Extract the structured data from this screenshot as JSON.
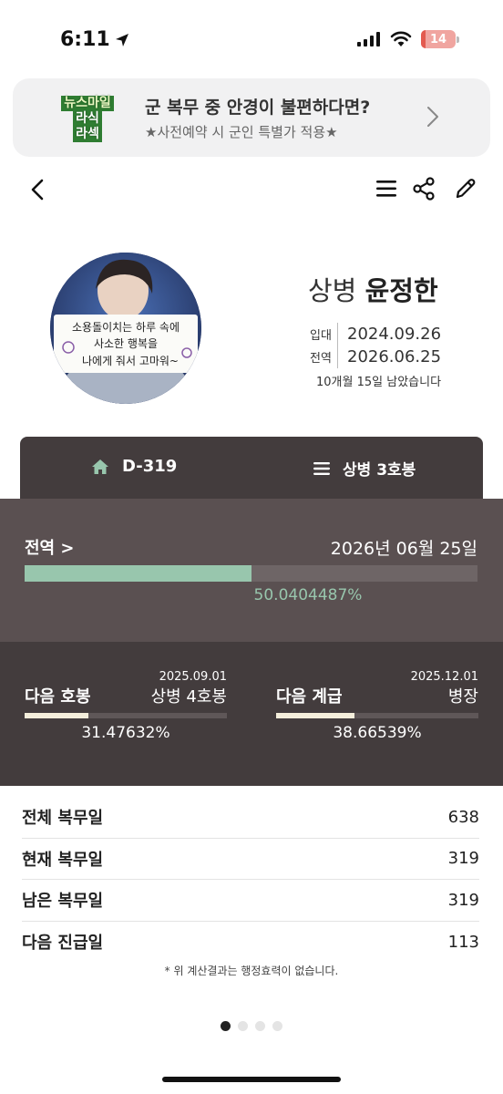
{
  "status_bar": {
    "time": "6:11",
    "battery": "14",
    "battery_level": 0.14
  },
  "ad": {
    "logo_lines": [
      "뉴스마일",
      "라식",
      "라섹"
    ],
    "title": "군 복무 중 안경이 불편하다면?",
    "subtitle": "★사전예약 시 군인 특별가 적용★"
  },
  "nav": {
    "icons": [
      "back-chevron-icon",
      "menu-icon",
      "share-icon",
      "edit-pencil-icon"
    ]
  },
  "profile": {
    "rank": "상병",
    "name": "윤정한",
    "enlist_label": "입대",
    "enlist_date": "2024.09.26",
    "discharge_label": "전역",
    "discharge_date": "2026.06.25",
    "remaining": "10개월 15일 남았습니다"
  },
  "tabs": {
    "dday": "D-319",
    "grade": "상병 3호봉"
  },
  "discharge": {
    "label": "전역 >",
    "date": "2026년 06월 25일",
    "percent_text": "50.0404487%",
    "progress": 0.500404487
  },
  "next": {
    "step": {
      "title": "다음 호봉",
      "date": "2025.09.01",
      "value": "상병 4호봉",
      "percent_text": "31.47632%",
      "progress": 0.3147632
    },
    "rank": {
      "title": "다음 계급",
      "date": "2025.12.01",
      "value": "병장",
      "percent_text": "38.66539%",
      "progress": 0.3866539
    }
  },
  "stats": [
    {
      "label": "전체 복무일",
      "value": "638"
    },
    {
      "label": "현재 복무일",
      "value": "319"
    },
    {
      "label": "남은 복무일",
      "value": "319"
    },
    {
      "label": "다음 진급일",
      "value": "113"
    }
  ],
  "footnote": "* 위 계산결과는 행정효력이 없습니다.",
  "pager": {
    "count": 4,
    "active": 0
  },
  "colors": {
    "accent_green": "#98c6ad",
    "card_dark": "#433c3d",
    "card_mid": "#5a5051",
    "cream": "#f4eedb",
    "battery_red": "#e35a4f"
  }
}
